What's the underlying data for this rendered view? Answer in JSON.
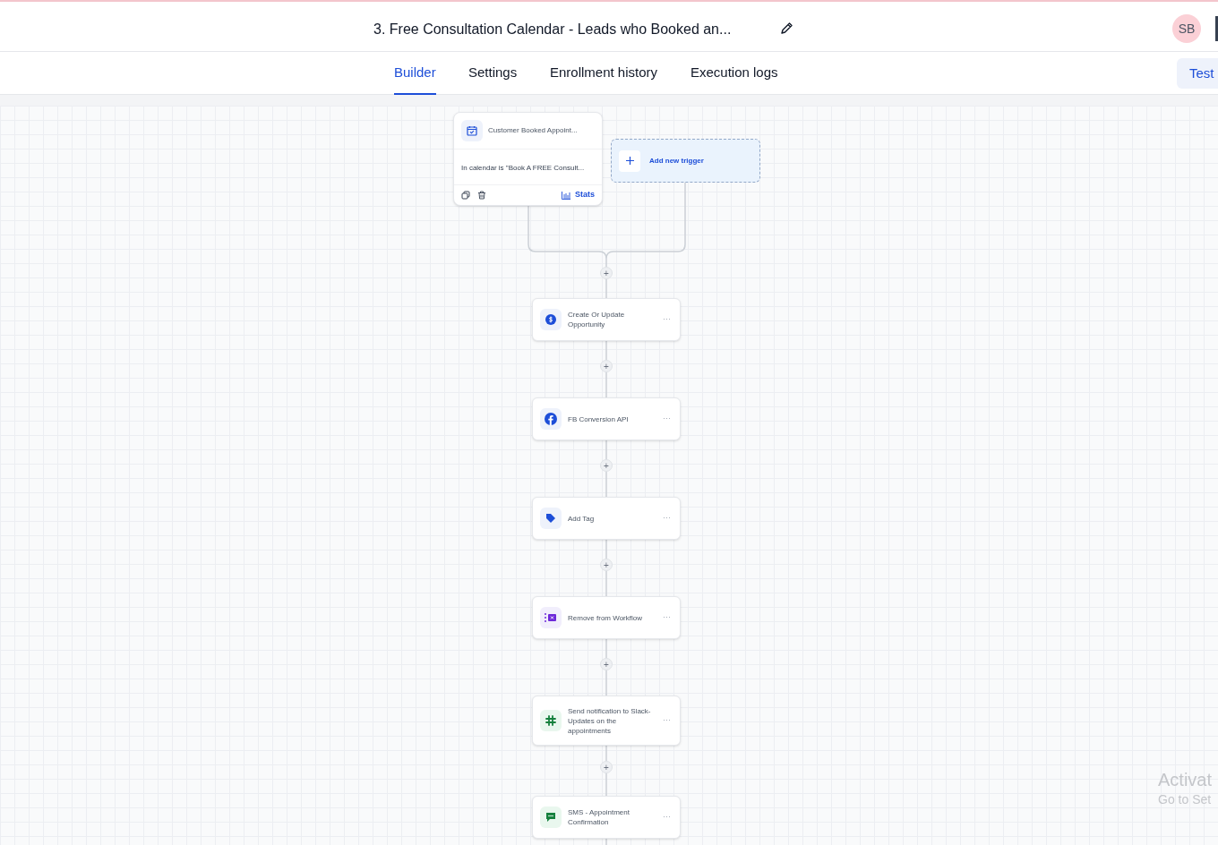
{
  "header": {
    "title": "3. Free Consultation Calendar - Leads who Booked an...",
    "avatar": "SB"
  },
  "tabs": [
    {
      "label": "Builder",
      "selected": true
    },
    {
      "label": "Settings",
      "selected": false
    },
    {
      "label": "Enrollment history",
      "selected": false
    },
    {
      "label": "Execution logs",
      "selected": false
    }
  ],
  "test_button": "Test",
  "trigger": {
    "title": "Customer Booked Appoint...",
    "filter": "In calendar is \"Book A FREE Consult...",
    "stats": "Stats"
  },
  "add_trigger": "Add new trigger",
  "actions": [
    {
      "kind": "opportunity",
      "label": "Create Or Update Opportunity",
      "menu": "···"
    },
    {
      "kind": "facebook",
      "label": "FB Conversion API",
      "menu": "···"
    },
    {
      "kind": "tag",
      "label": "Add Tag",
      "menu": "···"
    },
    {
      "kind": "remove",
      "label": "Remove from Workflow",
      "menu": "···"
    },
    {
      "kind": "slack",
      "label": "Send notification to Slack- Updates on the appointments",
      "menu": "···"
    },
    {
      "kind": "sms",
      "label": "SMS - Appointment Confirmation",
      "menu": "···"
    }
  ],
  "add_step": "+",
  "os_notice": {
    "title": "Activat",
    "subtitle": "Go to Set"
  }
}
